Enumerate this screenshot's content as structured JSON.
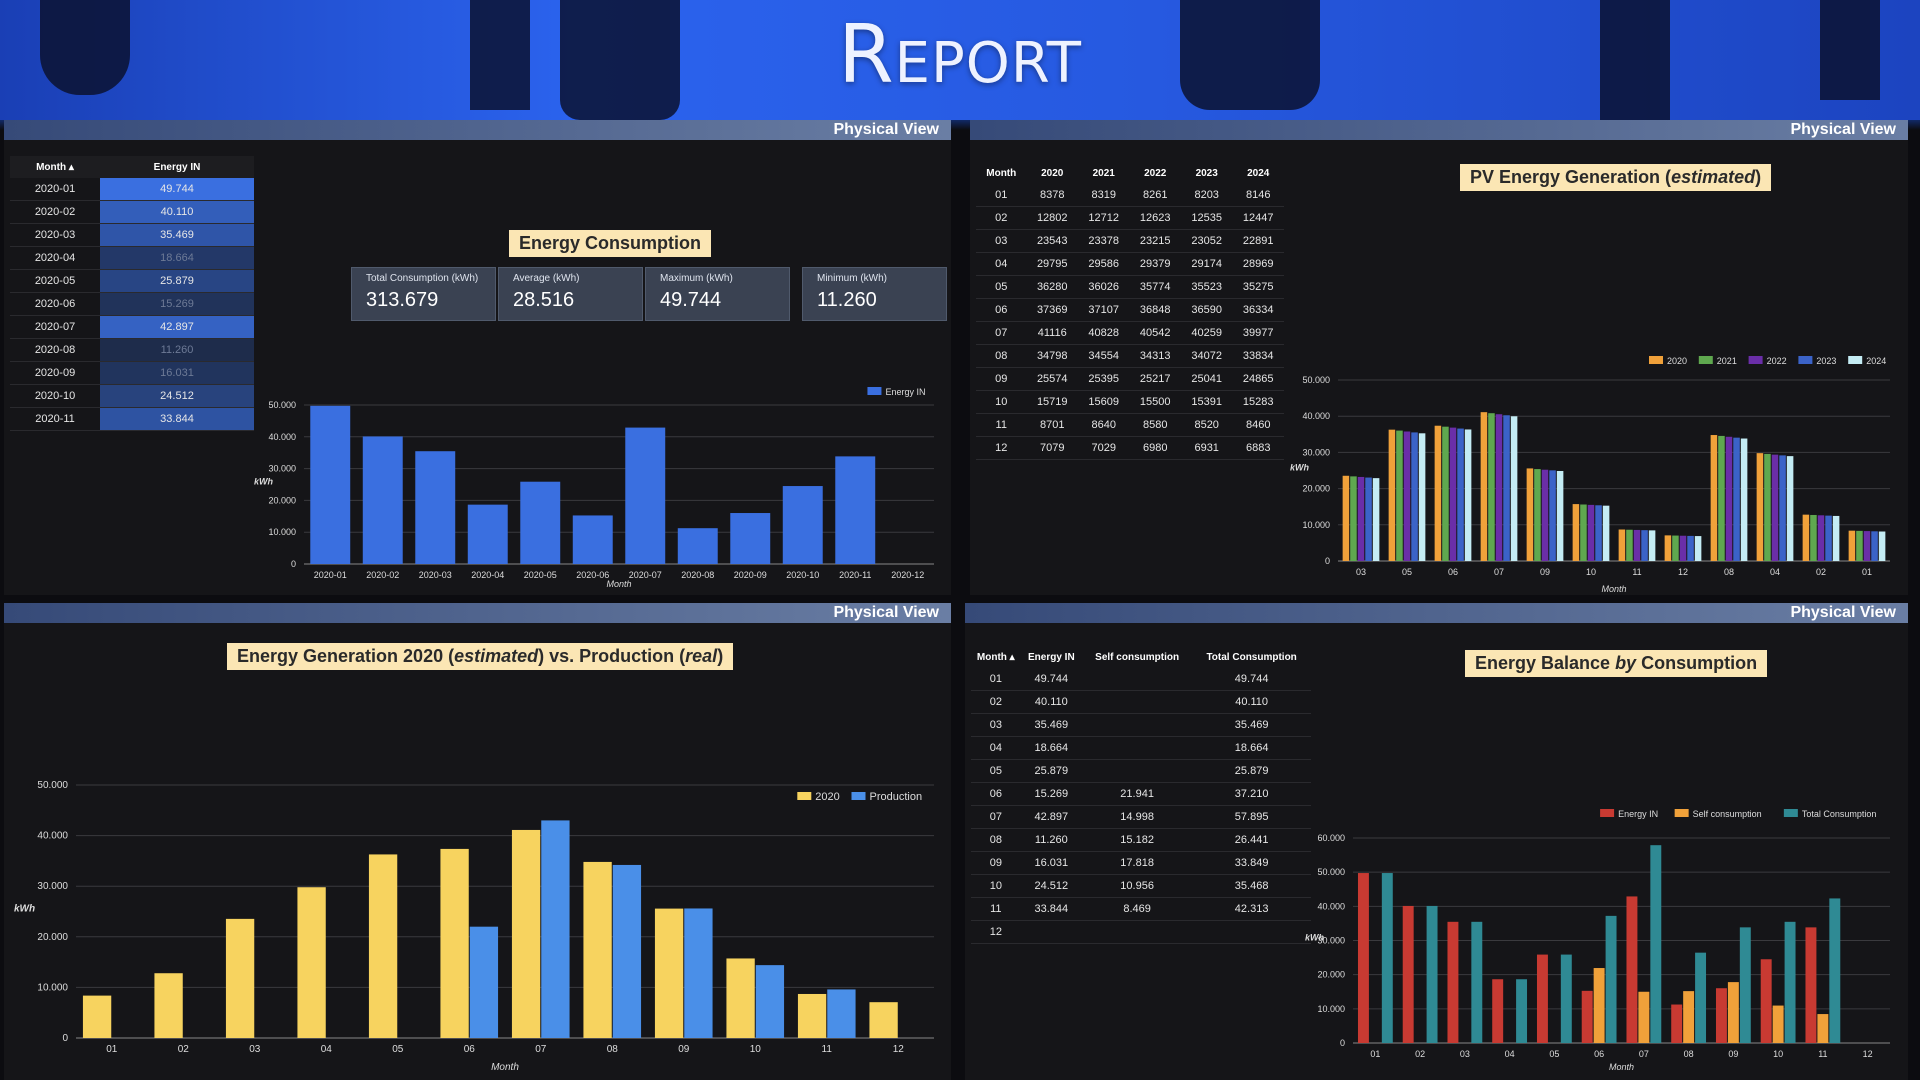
{
  "header": {
    "title": "Report"
  },
  "panel_label": "Physical View",
  "kpis": [
    {
      "label": "Total Consumption (kWh)",
      "value": "313.679"
    },
    {
      "label": "Average (kWh)",
      "value": "28.516"
    },
    {
      "label": "Maximum (kWh)",
      "value": "49.744"
    },
    {
      "label": "Minimum (kWh)",
      "value": "11.260"
    }
  ],
  "energy_table": {
    "headers": [
      "Month ▴",
      "Energy IN"
    ],
    "rows": [
      {
        "month": "2020-01",
        "value": "49.744"
      },
      {
        "month": "2020-02",
        "value": "40.110"
      },
      {
        "month": "2020-03",
        "value": "35.469"
      },
      {
        "month": "2020-04",
        "value": "18.664"
      },
      {
        "month": "2020-05",
        "value": "25.879"
      },
      {
        "month": "2020-06",
        "value": "15.269"
      },
      {
        "month": "2020-07",
        "value": "42.897"
      },
      {
        "month": "2020-08",
        "value": "11.260"
      },
      {
        "month": "2020-09",
        "value": "16.031"
      },
      {
        "month": "2020-10",
        "value": "24.512"
      },
      {
        "month": "2020-11",
        "value": "33.844"
      }
    ]
  },
  "pv_table": {
    "headers": [
      "Month",
      "2020",
      "2021",
      "2022",
      "2023",
      "2024"
    ],
    "rows": [
      [
        "01",
        "8378",
        "8319",
        "8261",
        "8203",
        "8146"
      ],
      [
        "02",
        "12802",
        "12712",
        "12623",
        "12535",
        "12447"
      ],
      [
        "03",
        "23543",
        "23378",
        "23215",
        "23052",
        "22891"
      ],
      [
        "04",
        "29795",
        "29586",
        "29379",
        "29174",
        "28969"
      ],
      [
        "05",
        "36280",
        "36026",
        "35774",
        "35523",
        "35275"
      ],
      [
        "06",
        "37369",
        "37107",
        "36848",
        "36590",
        "36334"
      ],
      [
        "07",
        "41116",
        "40828",
        "40542",
        "40259",
        "39977"
      ],
      [
        "08",
        "34798",
        "34554",
        "34313",
        "34072",
        "33834"
      ],
      [
        "09",
        "25574",
        "25395",
        "25217",
        "25041",
        "24865"
      ],
      [
        "10",
        "15719",
        "15609",
        "15500",
        "15391",
        "15283"
      ],
      [
        "11",
        "8701",
        "8640",
        "8580",
        "8520",
        "8460"
      ],
      [
        "12",
        "7079",
        "7029",
        "6980",
        "6931",
        "6883"
      ]
    ]
  },
  "balance_table": {
    "headers": [
      "Month ▴",
      "Energy IN",
      "Self consumption",
      "Total Consumption"
    ],
    "rows": [
      [
        "01",
        "49.744",
        "",
        "49.744"
      ],
      [
        "02",
        "40.110",
        "",
        "40.110"
      ],
      [
        "03",
        "35.469",
        "",
        "35.469"
      ],
      [
        "04",
        "18.664",
        "",
        "18.664"
      ],
      [
        "05",
        "25.879",
        "",
        "25.879"
      ],
      [
        "06",
        "15.269",
        "21.941",
        "37.210"
      ],
      [
        "07",
        "42.897",
        "14.998",
        "57.895"
      ],
      [
        "08",
        "11.260",
        "15.182",
        "26.441"
      ],
      [
        "09",
        "16.031",
        "17.818",
        "33.849"
      ],
      [
        "10",
        "24.512",
        "10.956",
        "35.468"
      ],
      [
        "11",
        "33.844",
        "8.469",
        "42.313"
      ],
      [
        "12",
        "",
        "",
        ""
      ]
    ]
  },
  "chart_data": [
    {
      "type": "bar",
      "title": "Energy Consumption",
      "xlabel": "Month",
      "ylabel": "kWh",
      "ylim": [
        0,
        50000
      ],
      "yticks": [
        "0",
        "10.000",
        "20.000",
        "30.000",
        "40.000",
        "50.000"
      ],
      "categories": [
        "2020-01",
        "2020-02",
        "2020-03",
        "2020-04",
        "2020-05",
        "2020-06",
        "2020-07",
        "2020-08",
        "2020-09",
        "2020-10",
        "2020-11",
        "2020-12"
      ],
      "series": [
        {
          "name": "Energy IN",
          "color": "#3a6fe0",
          "values": [
            49744,
            40110,
            35469,
            18664,
            25879,
            15269,
            42897,
            11260,
            16031,
            24512,
            33844,
            0
          ]
        }
      ]
    },
    {
      "type": "bar",
      "title_parts": [
        "PV Energy Generation (",
        "estimated",
        ")"
      ],
      "xlabel": "Month",
      "ylabel": "kWh",
      "ylim": [
        0,
        50000
      ],
      "yticks": [
        "0",
        "10.000",
        "20.000",
        "30.000",
        "40.000",
        "50.000"
      ],
      "categories": [
        "03",
        "05",
        "06",
        "07",
        "09",
        "10",
        "11",
        "12",
        "08",
        "04",
        "02",
        "01"
      ],
      "series": [
        {
          "name": "2020",
          "color": "#f0a13a",
          "values": [
            23543,
            36280,
            37369,
            41116,
            25574,
            15719,
            8701,
            7079,
            34798,
            29795,
            12802,
            8378
          ]
        },
        {
          "name": "2021",
          "color": "#5fa84f",
          "values": [
            23378,
            36026,
            37107,
            40828,
            25395,
            15609,
            8640,
            7029,
            34554,
            29586,
            12712,
            8319
          ]
        },
        {
          "name": "2022",
          "color": "#6a2ea8",
          "values": [
            23215,
            35774,
            36848,
            40542,
            25217,
            15500,
            8580,
            6980,
            34313,
            29379,
            12623,
            8261
          ]
        },
        {
          "name": "2023",
          "color": "#3b63c8",
          "values": [
            23052,
            35523,
            36590,
            40259,
            25041,
            15391,
            8520,
            6931,
            34072,
            29174,
            12535,
            8203
          ]
        },
        {
          "name": "2024",
          "color": "#c4ecf4",
          "values": [
            22891,
            35275,
            36334,
            39977,
            24865,
            15283,
            8460,
            6883,
            33834,
            28969,
            12447,
            8146
          ]
        }
      ]
    },
    {
      "type": "bar",
      "title_parts": [
        "Energy Generation 2020 (",
        "estimated",
        ") vs. Production (",
        "real",
        ")"
      ],
      "xlabel": "Month",
      "ylabel": "kWh",
      "ylim": [
        0,
        50000
      ],
      "yticks": [
        "0",
        "10.000",
        "20.000",
        "30.000",
        "40.000",
        "50.000"
      ],
      "categories": [
        "01",
        "02",
        "03",
        "04",
        "05",
        "06",
        "07",
        "08",
        "09",
        "10",
        "11",
        "12"
      ],
      "series": [
        {
          "name": "2020",
          "color": "#f7d35f",
          "values": [
            8378,
            12802,
            23543,
            29795,
            36280,
            37369,
            41116,
            34798,
            25574,
            15719,
            8701,
            7079
          ]
        },
        {
          "name": "Production",
          "color": "#4a8fe8",
          "values": [
            0,
            0,
            0,
            0,
            0,
            22000,
            43000,
            34200,
            25600,
            14400,
            9600,
            0
          ]
        }
      ]
    },
    {
      "type": "bar",
      "title_parts": [
        "Energy Balance ",
        "by",
        " Consumption"
      ],
      "xlabel": "Month",
      "ylabel": "kWh",
      "ylim": [
        0,
        60000
      ],
      "yticks": [
        "0",
        "10.000",
        "20.000",
        "30.000",
        "40.000",
        "50.000",
        "60.000"
      ],
      "categories": [
        "01",
        "02",
        "03",
        "04",
        "05",
        "06",
        "07",
        "08",
        "09",
        "10",
        "11",
        "12"
      ],
      "series": [
        {
          "name": "Energy IN",
          "color": "#c83a32",
          "values": [
            49744,
            40110,
            35469,
            18664,
            25879,
            15269,
            42897,
            11260,
            16031,
            24512,
            33844,
            0
          ]
        },
        {
          "name": "Self consumption",
          "color": "#f0a13a",
          "values": [
            0,
            0,
            0,
            0,
            0,
            21941,
            14998,
            15182,
            17818,
            10956,
            8469,
            0
          ]
        },
        {
          "name": "Total Consumption",
          "color": "#2f8a94",
          "values": [
            49744,
            40110,
            35469,
            18664,
            25879,
            37210,
            57895,
            26441,
            33849,
            35468,
            42313,
            0
          ]
        }
      ]
    }
  ]
}
